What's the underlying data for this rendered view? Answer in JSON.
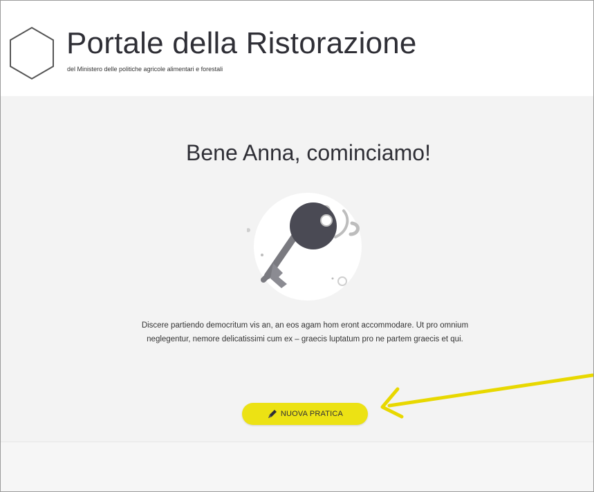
{
  "header": {
    "title": "Portale della Ristorazione",
    "subtitle": "del Ministero delle politiche agricole alimentari e forestali",
    "logo_icon": "hexagon-icon"
  },
  "main": {
    "greeting": "Bene Anna, cominciamo!",
    "illustration_icon": "key-icon",
    "intro_text": "Discere partiendo democritum vis an, an eos agam hom eront accommodare. Ut pro omnium neglegentur, nemore delicatissimi cum ex – graecis luptatum pro ne partem graecis et qui.",
    "new_button": {
      "label": "NUOVA PRATICA",
      "icon": "pencil-icon"
    }
  },
  "annotation": {
    "arrow_icon": "arrow-left-icon",
    "arrow_color": "#e8d800"
  },
  "colors": {
    "button": "#ece214",
    "background": "#f3f3f3",
    "text": "#2f2f36"
  }
}
